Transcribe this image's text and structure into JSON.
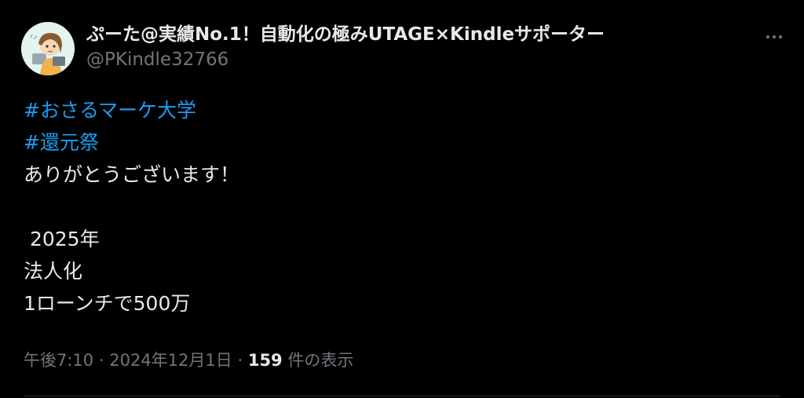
{
  "author": {
    "display_name": "ぷーた@実績No.1！自動化の極みUTAGE×Kindleサポーター",
    "handle": "@PKindle32766",
    "avatar_icon": "cartoon-avatar-icon"
  },
  "menu": {
    "more_icon": "more-horizontal-icon"
  },
  "tweet": {
    "hashtags": [
      "#おさるマーケ大学",
      "#還元祭"
    ],
    "lines": [
      "ありがとうございます！",
      "",
      " 2025年",
      "法人化",
      "1ローンチで500万"
    ]
  },
  "meta": {
    "time": "午後7:10",
    "separator": "·",
    "date": "2024年12月1日",
    "views_count": "159",
    "views_label": "件の表示"
  },
  "colors": {
    "background": "#000000",
    "text": "#e7e9ea",
    "secondary": "#71767b",
    "accent": "#1d9bf0"
  }
}
